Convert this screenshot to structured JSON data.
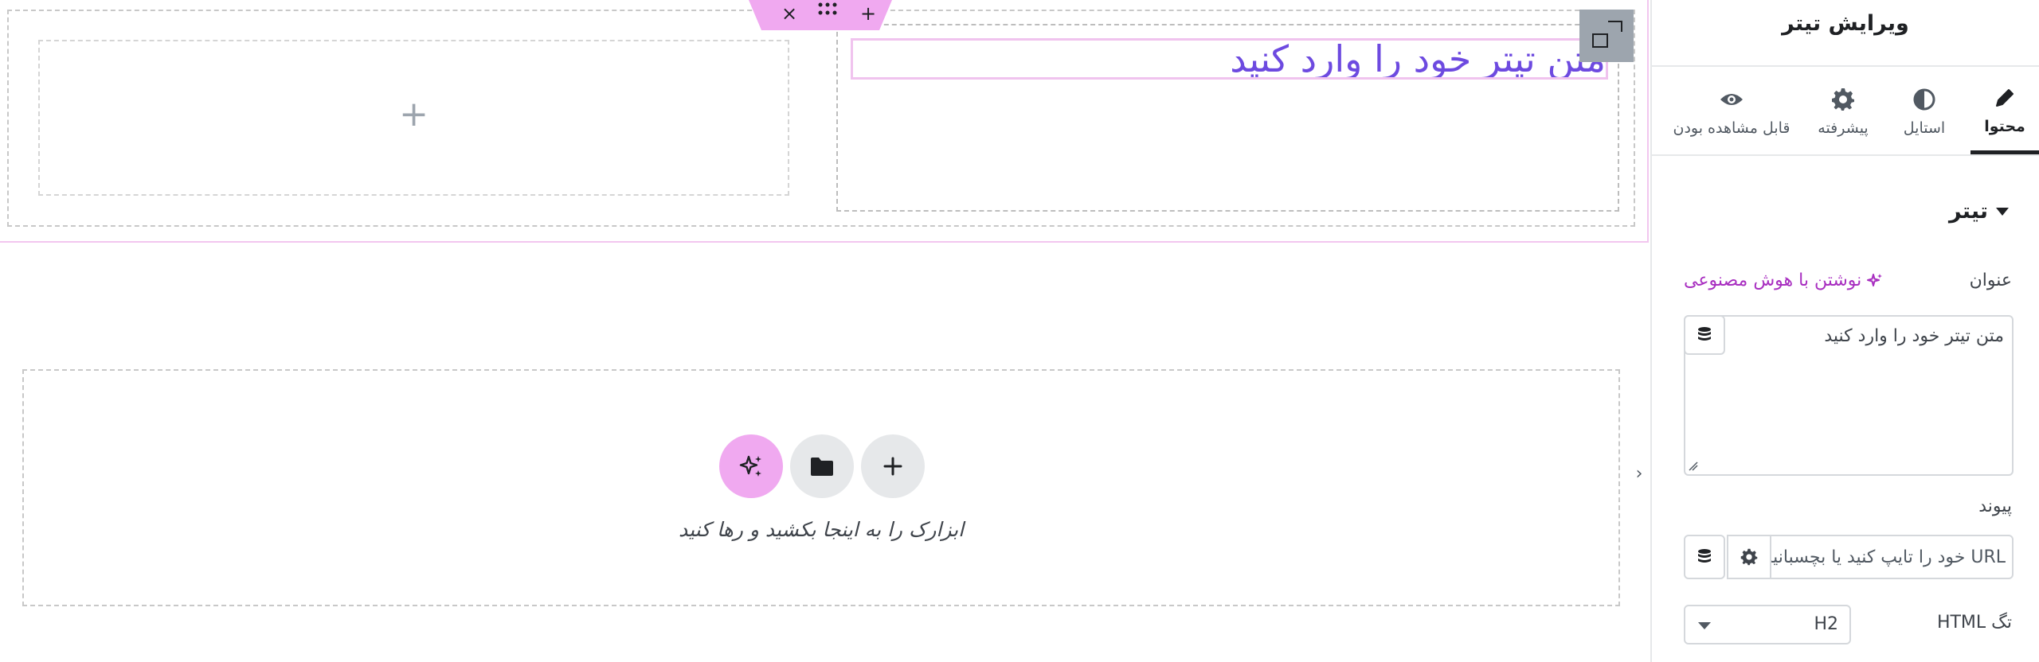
{
  "canvas": {
    "heading_text": "متن تیتر خود را وارد کنید",
    "add_column_symbol": "+",
    "handle_add_symbol": "+",
    "handle_close_symbol": "×",
    "drop_hint": "ابزارک را به اینجا بکشید و رها کنید",
    "collapse_symbol": "›"
  },
  "panel": {
    "title": "ویرایش تیتر",
    "tabs": [
      {
        "label": "محتوا",
        "icon": "pencil-icon",
        "active": true
      },
      {
        "label": "استایل",
        "icon": "half-circle-icon",
        "active": false
      },
      {
        "label": "پیشرفته",
        "icon": "gear-icon",
        "active": false
      },
      {
        "label": "قابل مشاهده بودن",
        "icon": "eye-icon",
        "active": false
      }
    ],
    "section_title": "تیتر",
    "title_field": {
      "label": "عنوان",
      "ai_link": "نوشتن با هوش مصنوعی",
      "value": "متن تیتر خود را وارد کنید"
    },
    "link_field": {
      "label": "پیوند",
      "placeholder": "URL خود را تایپ کنید یا بچسبانید"
    },
    "html_tag_field": {
      "label": "تگ HTML",
      "value": "H2"
    }
  },
  "colors": {
    "accent_purple": "#6d4ae0",
    "ai_pink": "#a82ec0",
    "selection_pink": "#f0c3ee"
  }
}
